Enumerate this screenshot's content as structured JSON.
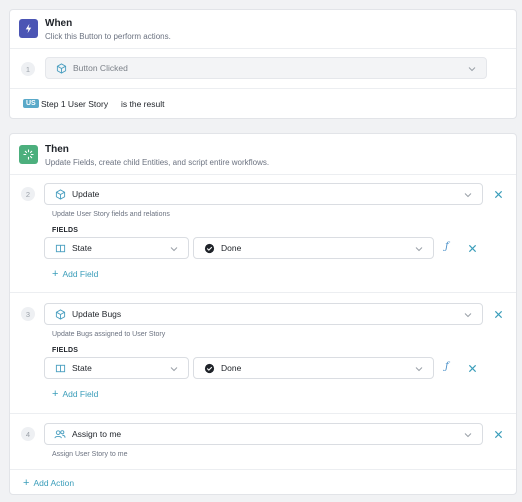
{
  "when": {
    "title": "When",
    "subtitle": "Click this Button to perform actions.",
    "step_number": "1",
    "trigger_label": "Button Clicked",
    "result_badge": "US",
    "result_step": "Step 1 User Story",
    "result_text": "is the result"
  },
  "then": {
    "title": "Then",
    "subtitle": "Update Fields, create child Entities, and script entire workflows.",
    "actions": [
      {
        "number": "2",
        "label": "Update",
        "description": "Update User Story fields and relations",
        "fields_label": "FIELDS",
        "field_name": "State",
        "field_value": "Done",
        "add_field": "Add Field"
      },
      {
        "number": "3",
        "label": "Update Bugs",
        "description": "Update Bugs assigned to User Story",
        "fields_label": "FIELDS",
        "field_name": "State",
        "field_value": "Done",
        "add_field": "Add Field"
      },
      {
        "number": "4",
        "label": "Assign to me",
        "description": "Assign User Story to me"
      }
    ],
    "add_action": "Add Action"
  },
  "colors": {
    "when_icon_bg": "#4b55b4",
    "then_icon_bg": "#4caf7d",
    "link": "#3a9dba",
    "badge_bg": "#5aa9c9"
  },
  "icons": {
    "when": "lightning-icon",
    "then": "sparkle-icon",
    "trigger": "cube-icon",
    "update": "cube-icon",
    "field": "field-icon",
    "value": "check-circle-icon",
    "formula": "function-icon",
    "remove": "close-icon",
    "assign": "users-icon"
  }
}
